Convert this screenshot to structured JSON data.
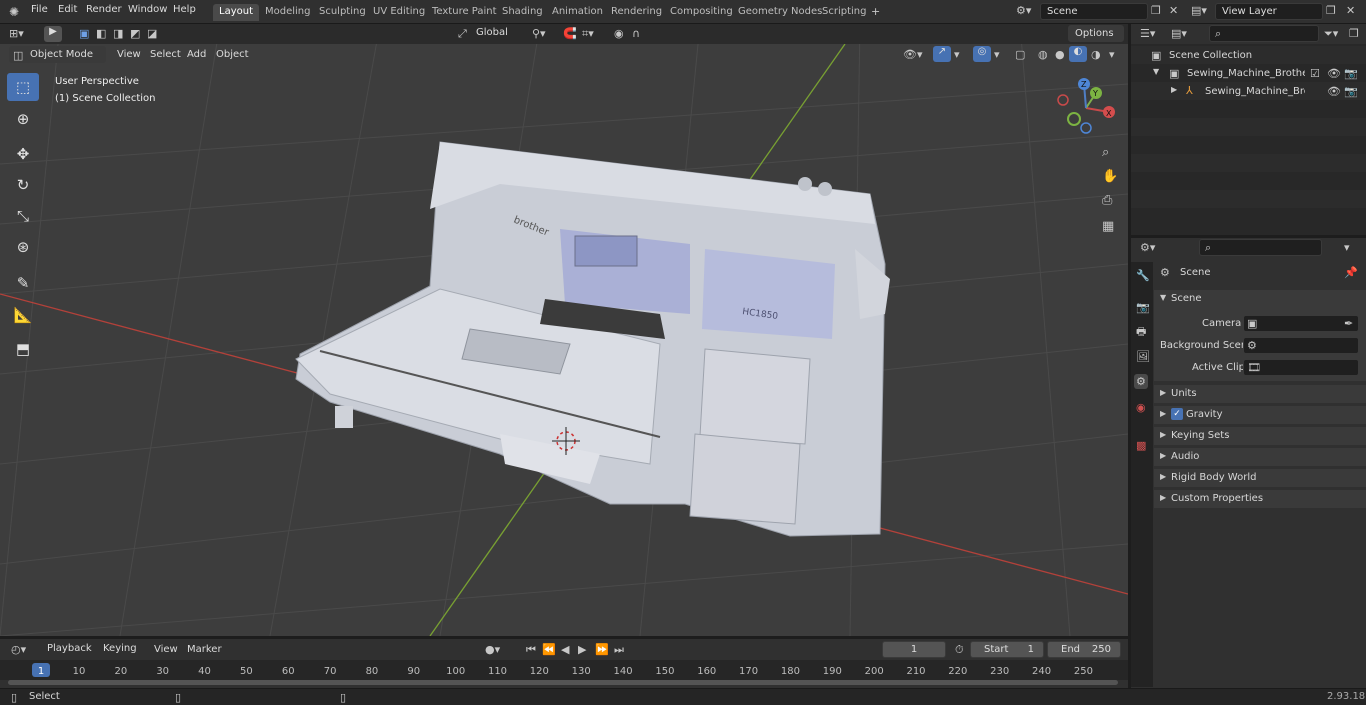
{
  "menus": [
    "File",
    "Edit",
    "Render",
    "Window",
    "Help"
  ],
  "workspaces": [
    "Layout",
    "Modeling",
    "Sculpting",
    "UV Editing",
    "Texture Paint",
    "Shading",
    "Animation",
    "Rendering",
    "Compositing",
    "Geometry Nodes",
    "Scripting"
  ],
  "active_workspace": "Layout",
  "scene_field": "Scene",
  "view_layer_field": "View Layer",
  "viewport_header": {
    "mode": "Object Mode",
    "menu": [
      "View",
      "Select",
      "Add",
      "Object"
    ],
    "transform_orientation": "Global",
    "options": "Options"
  },
  "viewport_overlay_text": {
    "perspective": "User Perspective",
    "collection": "(1) Scene Collection"
  },
  "gizmo_labels": {
    "x": "X",
    "y": "Y",
    "z": "Z"
  },
  "outliner": {
    "root": "Scene Collection",
    "collection": "Sewing_Machine_Brother_HC",
    "object": "Sewing_Machine_Brother"
  },
  "properties": {
    "header": "Scene",
    "panel": "Scene",
    "fields": [
      {
        "label": "Camera",
        "value": ""
      },
      {
        "label": "Background Scene",
        "value": ""
      },
      {
        "label": "Active Clip",
        "value": ""
      }
    ],
    "subpanels": [
      "Units",
      "Gravity",
      "Keying Sets",
      "Audio",
      "Rigid Body World",
      "Custom Properties"
    ],
    "gravity_checked": true
  },
  "timeline": {
    "menus": [
      "Playback",
      "Keying",
      "View",
      "Marker"
    ],
    "current_frame": "1",
    "start_label": "Start",
    "start": "1",
    "end_label": "End",
    "end": "250",
    "ticks": [
      "1",
      "10",
      "20",
      "30",
      "40",
      "50",
      "60",
      "70",
      "80",
      "90",
      "100",
      "110",
      "120",
      "130",
      "140",
      "150",
      "160",
      "170",
      "180",
      "190",
      "200",
      "210",
      "220",
      "230",
      "240",
      "250"
    ]
  },
  "status": {
    "left": "Select",
    "version": "2.93.18"
  },
  "model_labels": {
    "brand": "brother",
    "model": "HC1850"
  },
  "colors": {
    "accent": "#4772b3",
    "viewport_bg": "#3d3d3d",
    "x_axis": "#c0392b",
    "y_axis": "#6a9a2a"
  }
}
